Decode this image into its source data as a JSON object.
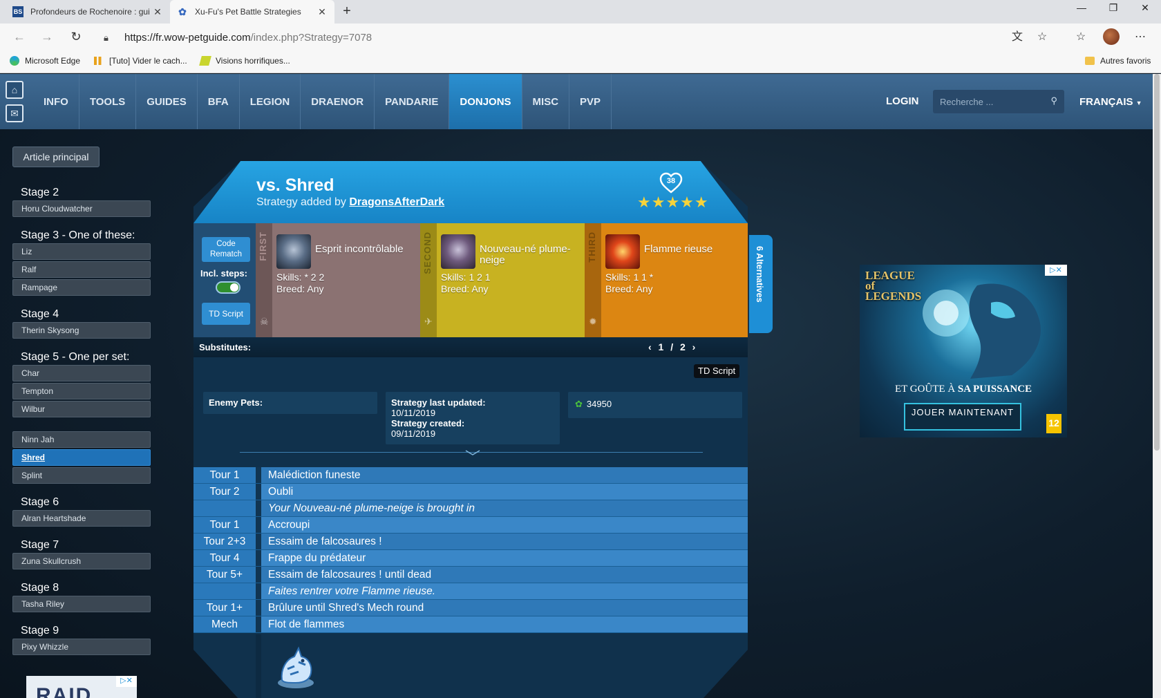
{
  "browser": {
    "tabs": [
      {
        "title": "Profondeurs de Rochenoire : gui",
        "favicon": "BS",
        "active": false
      },
      {
        "title": "Xu-Fu's Pet Battle Strategies",
        "favicon": "paw-icon",
        "active": true
      }
    ],
    "url_host": "https://fr.wow-petguide.com",
    "url_path": "/index.php?Strategy=7078",
    "bookmarks": [
      {
        "label": "Microsoft Edge",
        "icon": "edge-icon"
      },
      {
        "label": "[Tuto] Vider le cach...",
        "icon": "bookmark-icon"
      },
      {
        "label": "Visions horrifiques...",
        "icon": "bookmark-icon"
      }
    ],
    "other_favorites": "Autres favoris"
  },
  "site": {
    "menu": [
      "INFO",
      "TOOLS",
      "GUIDES",
      "BFA",
      "LEGION",
      "DRAENOR",
      "PANDARIE",
      "DONJONS",
      "MISC",
      "PVP"
    ],
    "active_menu": "DONJONS",
    "login": "LOGIN",
    "search_placeholder": "Recherche ...",
    "language": "FRANÇAIS"
  },
  "sidebar": {
    "main_article": "Article principal",
    "stages": [
      {
        "title": "Stage 2",
        "npcs": [
          "Horu Cloudwatcher"
        ]
      },
      {
        "title": "Stage 3 - One of these:",
        "npcs": [
          "Liz",
          "Ralf",
          "Rampage"
        ]
      },
      {
        "title": "Stage 4",
        "npcs": [
          "Therin Skysong"
        ]
      },
      {
        "title": "Stage 5 - One per set:",
        "npcs": [
          "Char",
          "Tempton",
          "Wilbur"
        ]
      },
      {
        "title": "",
        "npcs": [
          "Ninn Jah",
          "Shred",
          "Splint"
        ]
      },
      {
        "title": "Stage 6",
        "npcs": [
          "Alran Heartshade"
        ]
      },
      {
        "title": "Stage 7",
        "npcs": [
          "Zuna Skullcrush"
        ]
      },
      {
        "title": "Stage 8",
        "npcs": [
          "Tasha Riley"
        ]
      },
      {
        "title": "Stage 9",
        "npcs": [
          "Pixy Whizzle"
        ]
      }
    ],
    "active_npc": "Shred"
  },
  "strategy": {
    "title": "vs. Shred",
    "added_by_prefix": "Strategy added by",
    "author": "DragonsAfterDark",
    "likes": "38",
    "rating_stars": 5,
    "code_rematch": "Code Rematch",
    "incl_steps": "Incl. steps:",
    "td_script": "TD Script",
    "substitutes": "Substitutes:",
    "pagination": "‹ 1 / 2 ›",
    "alternatives": "6 Alternatives",
    "pets": [
      {
        "slot": "FIRST",
        "name": "Esprit incontrôlable",
        "skills": "Skills: * 2 2",
        "breed": "Breed: Any",
        "family_icon": "undead-icon",
        "color": "#8b7272"
      },
      {
        "slot": "SECOND",
        "name": "Nouveau-né plume-neige",
        "skills": "Skills: 1 2 1",
        "breed": "Breed: Any",
        "family_icon": "flying-icon",
        "color": "#c8b221"
      },
      {
        "slot": "THIRD",
        "name": "Flamme rieuse",
        "skills": "Skills: 1 1 *",
        "breed": "Breed: Any",
        "family_icon": "elemental-icon",
        "color": "#dc8612"
      }
    ],
    "td_tag": "TD Script",
    "enemy_pets_label": "Enemy Pets:",
    "last_updated_label": "Strategy last updated:",
    "last_updated": "10/11/2019",
    "created_label": "Strategy created:",
    "created": "09/11/2019",
    "views": "34950",
    "steps": [
      {
        "turn": "Tour 1",
        "action": "Malédiction funeste",
        "note": false
      },
      {
        "turn": "Tour 2",
        "action": "Oubli",
        "note": false
      },
      {
        "turn": "",
        "action": "Your Nouveau-né plume-neige is brought in",
        "note": true
      },
      {
        "turn": "Tour 1",
        "action": "Accroupi",
        "note": false
      },
      {
        "turn": "Tour 2+3",
        "action": "Essaim de falcosaures !",
        "note": false
      },
      {
        "turn": "Tour 4",
        "action": "Frappe du prédateur",
        "note": false
      },
      {
        "turn": "Tour 5+",
        "action": "Essaim de falcosaures ! until dead",
        "note": false
      },
      {
        "turn": "",
        "action": "Faites rentrer votre Flamme rieuse.",
        "note": true
      },
      {
        "turn": "Tour 1+",
        "action": "Brûlure until Shred's Mech round",
        "note": false
      },
      {
        "turn": "Mech",
        "action": "Flot de flammes",
        "note": false
      }
    ]
  },
  "ad": {
    "brand": "LEAGUE of LEGENDS",
    "slogan_plain": "ET GOÛTE À",
    "slogan_bold": "SA PUISSANCE",
    "cta": "JOUER MAINTENANT",
    "age": "12",
    "side_ad_text": "RAID"
  }
}
